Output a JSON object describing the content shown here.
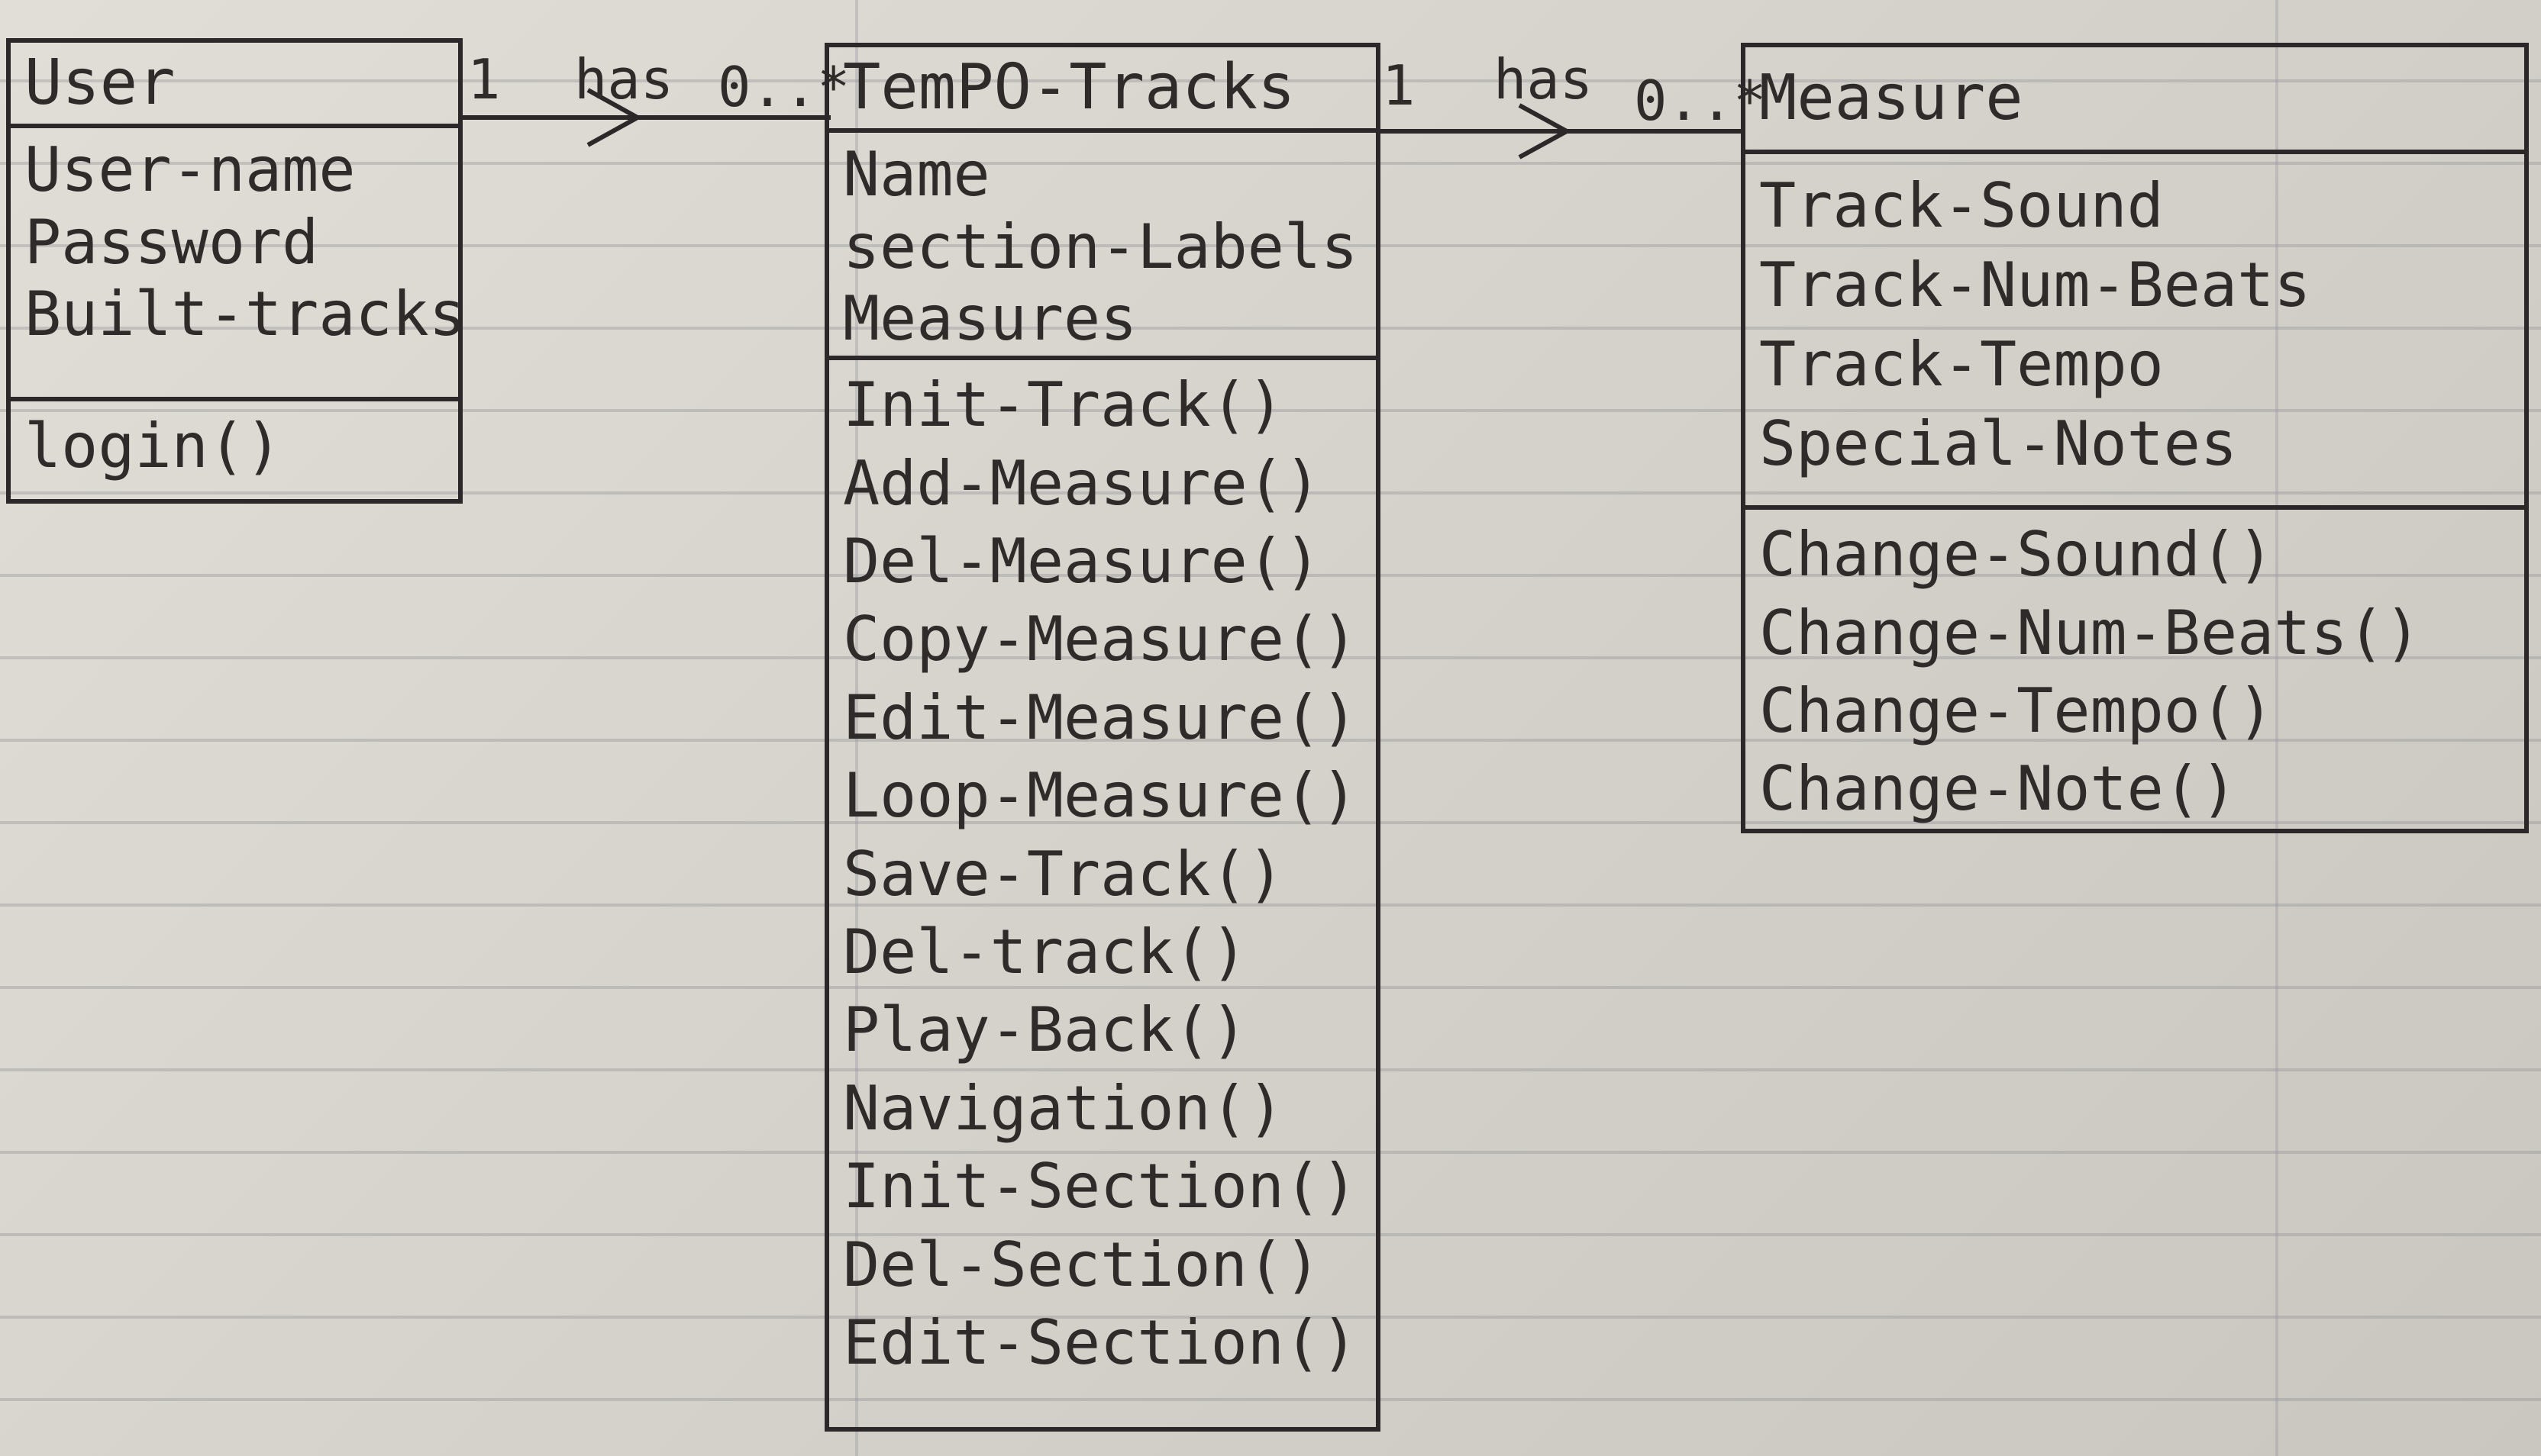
{
  "classes": {
    "user": {
      "name": "User",
      "attributes": [
        "User-name",
        "Password",
        "Built-tracks"
      ],
      "methods": [
        "login()"
      ]
    },
    "tempo_tracks": {
      "name": "TemPO-Tracks",
      "attributes": [
        "Name",
        "section-Labels",
        "Measures"
      ],
      "methods": [
        "Init-Track()",
        "Add-Measure()",
        "Del-Measure()",
        "Copy-Measure()",
        "Edit-Measure()",
        "Loop-Measure()",
        "Save-Track()",
        "Del-track()",
        "Play-Back()",
        "Navigation()",
        "Init-Section()",
        "Del-Section()",
        "Edit-Section()"
      ]
    },
    "measure": {
      "name": "Measure",
      "attributes": [
        "Track-Sound",
        "Track-Num-Beats",
        "Track-Tempo",
        "Special-Notes"
      ],
      "methods": [
        "Change-Sound()",
        "Change-Num-Beats()",
        "Change-Tempo()",
        "Change-Note()"
      ]
    }
  },
  "associations": [
    {
      "from": "User",
      "to": "TemPO-Tracks",
      "label": "has",
      "from_multiplicity": "1",
      "to_multiplicity": "0..*"
    },
    {
      "from": "TemPO-Tracks",
      "to": "Measure",
      "label": "has",
      "from_multiplicity": "1",
      "to_multiplicity": "0..*"
    }
  ]
}
